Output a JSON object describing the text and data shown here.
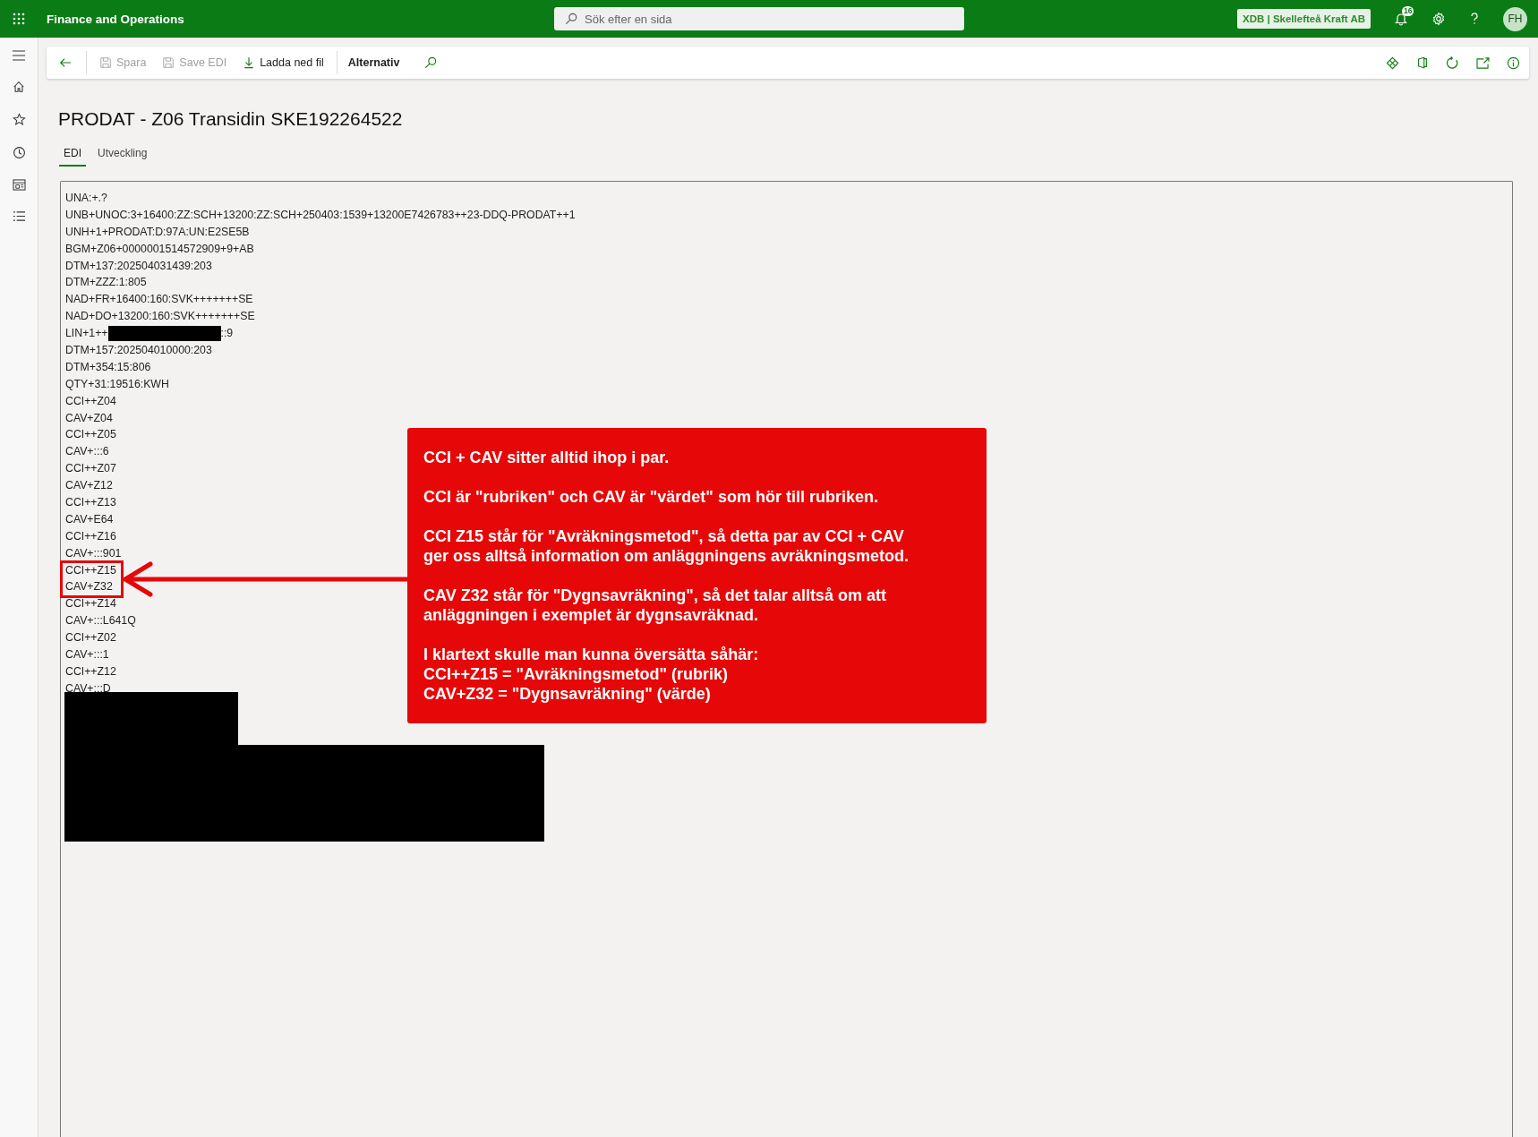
{
  "app_bar": {
    "title": "Finance and Operations",
    "search": {
      "placeholder": "Sök efter en sida"
    },
    "company": "XDB | Skellefteå Kraft AB",
    "notification_count": "16",
    "avatar": "FH"
  },
  "toolbar": {
    "items": [
      {
        "kind": "back",
        "disabled": false
      },
      {
        "kind": "save",
        "label": "Spara",
        "disabled": true
      },
      {
        "kind": "save",
        "label": "Save EDI",
        "disabled": true
      },
      {
        "kind": "download",
        "label": "Ladda ned fil",
        "disabled": false
      },
      {
        "kind": "menu",
        "label": "Alternativ",
        "disabled": false
      },
      {
        "kind": "search",
        "disabled": false
      }
    ]
  },
  "page_title": "PRODAT - Z06 Transidin SKE192264522",
  "tabs": [
    {
      "label": "EDI",
      "selected": true
    },
    {
      "label": "Utveckling",
      "selected": false
    }
  ],
  "edi_lines": [
    {
      "kind": "text",
      "text": "UNA:+.?"
    },
    {
      "kind": "text",
      "text": "UNB+UNOC:3+16400:ZZ:SCH+13200:ZZ:SCH+250403:1539+13200E7426783++23-DDQ-PRODAT++1"
    },
    {
      "kind": "text",
      "text": "UNH+1+PRODAT:D:97A:UN:E2SE5B"
    },
    {
      "kind": "text",
      "text": "BGM+Z06+0000001514572909+9+AB"
    },
    {
      "kind": "text",
      "text": "DTM+137:202504031439:203"
    },
    {
      "kind": "text",
      "text": "DTM+ZZZ:1:805"
    },
    {
      "kind": "text",
      "text": "NAD+FR+16400:160:SVK+++++++SE"
    },
    {
      "kind": "text",
      "text": "NAD+DO+13200:160:SVK+++++++SE"
    },
    {
      "kind": "redacted",
      "before": "LIN+1++",
      "after": "::9"
    },
    {
      "kind": "text",
      "text": "DTM+157:202504010000:203"
    },
    {
      "kind": "text",
      "text": "DTM+354:15:806"
    },
    {
      "kind": "text",
      "text": "QTY+31:19516:KWH"
    },
    {
      "kind": "text",
      "text": "CCI++Z04"
    },
    {
      "kind": "text",
      "text": "CAV+Z04"
    },
    {
      "kind": "text",
      "text": "CCI++Z05"
    },
    {
      "kind": "text",
      "text": "CAV+:::6"
    },
    {
      "kind": "text",
      "text": "CCI++Z07"
    },
    {
      "kind": "text",
      "text": "CAV+Z12"
    },
    {
      "kind": "text",
      "text": "CCI++Z13"
    },
    {
      "kind": "text",
      "text": "CAV+E64"
    },
    {
      "kind": "text",
      "text": "CCI++Z16"
    },
    {
      "kind": "text",
      "text": "CAV+:::901"
    },
    {
      "kind": "text",
      "text": "CCI++Z15",
      "highlighted": true
    },
    {
      "kind": "text",
      "text": "CAV+Z32",
      "highlighted": true
    },
    {
      "kind": "text",
      "text": "CCI++Z14"
    },
    {
      "kind": "text",
      "text": "CAV+:::L641Q"
    },
    {
      "kind": "text",
      "text": "CCI++Z02"
    },
    {
      "kind": "text",
      "text": "CAV+:::1"
    },
    {
      "kind": "text",
      "text": "CCI++Z12"
    },
    {
      "kind": "text",
      "text": "CAV+:::D"
    }
  ],
  "callout": {
    "paragraphs": [
      [
        "CCI + CAV sitter alltid ihop i par."
      ],
      [
        "CCI är \"rubriken\" och CAV är \"värdet\" som hör till rubriken."
      ],
      [
        "CCI Z15 står för \"Avräkningsmetod\", så detta par av CCI + CAV",
        "ger oss alltså information om anläggningens avräkningsmetod."
      ],
      [
        "CAV Z32 står för \"Dygnsavräkning\", så det talar alltså om att",
        "anläggningen i exemplet är dygnsavräknad."
      ],
      [
        "I klartext skulle man kunna översätta såhär:",
        "CCI++Z15 = \"Avräkningsmetod\" (rubrik)",
        "CAV+Z32 = \"Dygnsavräkning\" (värde)"
      ]
    ]
  }
}
